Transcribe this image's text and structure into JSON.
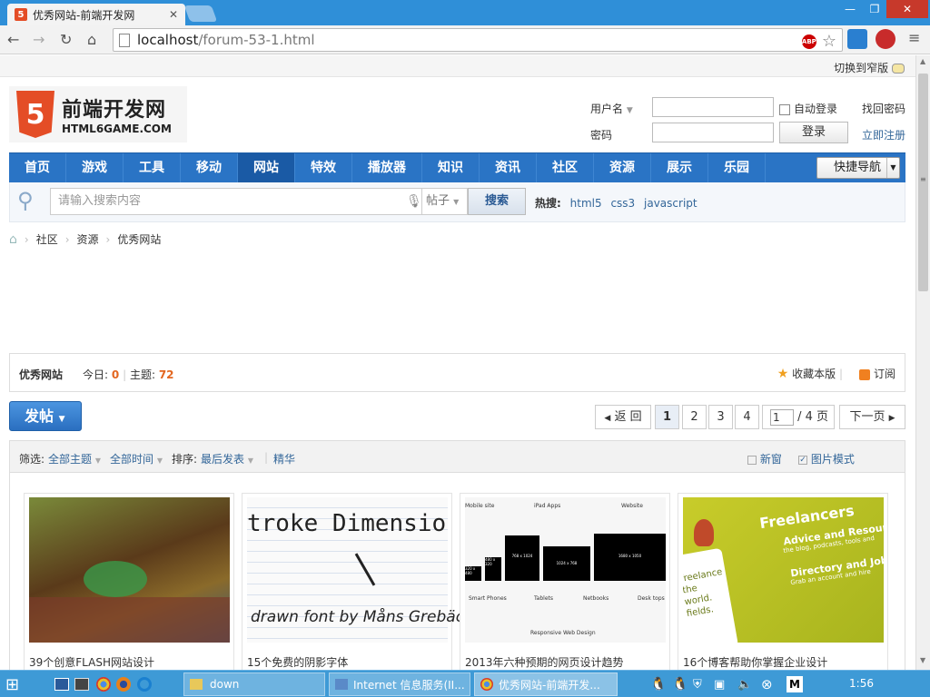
{
  "browser": {
    "tab_title": "优秀网站-前端开发网",
    "tab_favicon": "5",
    "url_host": "localhost",
    "url_path": "/forum-53-1.html",
    "abp_label": "ABP"
  },
  "site": {
    "switch_width": "切换到窄版",
    "logo_cn": "前端开发网",
    "logo_en": "HTML6GAME.COM",
    "logo_mark": "5",
    "login": {
      "username_label": "用户名",
      "password_label": "密码",
      "auto_login": "自动登录",
      "find_password": "找回密码",
      "login_button": "登录",
      "register": "立即注册"
    },
    "nav": [
      {
        "label": "首页"
      },
      {
        "label": "游戏"
      },
      {
        "label": "工具"
      },
      {
        "label": "移动"
      },
      {
        "label": "网站"
      },
      {
        "label": "特效"
      },
      {
        "label": "播放器"
      },
      {
        "label": "知识"
      },
      {
        "label": "资讯"
      },
      {
        "label": "社区"
      },
      {
        "label": "资源"
      },
      {
        "label": "展示"
      },
      {
        "label": "乐园"
      }
    ],
    "nav_active": 4,
    "quick_nav": "快捷导航",
    "search": {
      "placeholder": "请输入搜索内容",
      "type": "帖子",
      "button": "搜索",
      "hot_label": "热搜:",
      "hot": [
        "html5",
        "css3",
        "javascript"
      ]
    },
    "breadcrumb": [
      "社区",
      "资源",
      "优秀网站"
    ]
  },
  "forum": {
    "name": "优秀网站",
    "today_label": "今日:",
    "today": "0",
    "topics_label": "主题:",
    "topics": "72",
    "favorite": "收藏本版",
    "subscribe": "订阅",
    "post_button": "发帖",
    "pager": {
      "back": "返 回",
      "pages": [
        "1",
        "2",
        "3",
        "4"
      ],
      "current": "1",
      "input": "1",
      "total": "/ 4 页",
      "next": "下一页"
    },
    "filter": {
      "label": "筛选:",
      "all_topics": "全部主题",
      "all_time": "全部时间",
      "sort_label": "排序:",
      "sort": "最后发表",
      "digest": "精华",
      "new_window": "新窗",
      "image_mode": "图片模式"
    },
    "cards": [
      {
        "title": "39个创意FLASH网站设计"
      },
      {
        "title": "15个免费的阴影字体",
        "img_text1": "troke Dimensio",
        "img_text2": "drawn font by Måns Grebäc"
      },
      {
        "title": "2013年六种预期的网页设计趋势",
        "img_labels": [
          "Mobile site",
          "iPad Apps",
          "Website",
          "Smart Phones",
          "Tablets",
          "Netbooks",
          "Desk tops",
          "Responsive Web Design",
          "320 x 480",
          "480 x 320",
          "768 x 1024",
          "1024 x 768",
          "1680 x 1050"
        ]
      },
      {
        "title": "16个博客帮助你掌握企业设计",
        "img_texts": [
          "Freelancers",
          "Advice and Resourc",
          "the blog, podcasts, tools and",
          "Directory and Job",
          "Grab an account and hire",
          "freelance",
          "the world.",
          "fields."
        ]
      }
    ]
  },
  "taskbar": {
    "items": [
      "down",
      "Internet 信息服务(II...",
      "优秀网站-前端开发..."
    ],
    "clock": "1:56"
  }
}
